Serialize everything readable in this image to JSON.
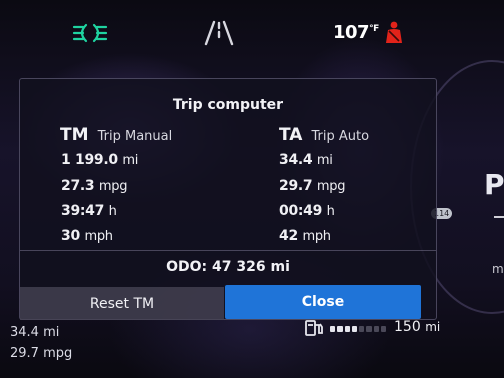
{
  "status_bar": {
    "temperature": "107",
    "temperature_unit": "°F",
    "icons": [
      "headlights-icon",
      "lane-keep-icon",
      "seatbelt-warning-icon"
    ],
    "colors": {
      "headlights": "#1fd3a0",
      "seatbelt": "#e2231a"
    }
  },
  "dialog": {
    "title": "Trip computer",
    "trip_manual": {
      "abbr": "TM",
      "name": "Trip Manual",
      "distance": "1 199.0",
      "distance_unit": "mi",
      "economy": "27.3",
      "economy_unit": "mpg",
      "time": "39:47",
      "time_unit": "h",
      "speed": "30",
      "speed_unit": "mph"
    },
    "trip_auto": {
      "abbr": "TA",
      "name": "Trip Auto",
      "distance": "34.4",
      "distance_unit": "mi",
      "economy": "29.7",
      "economy_unit": "mpg",
      "time": "00:49",
      "time_unit": "h",
      "speed": "42",
      "speed_unit": "mph"
    },
    "odometer_label": "ODO:",
    "odometer_value": "47 326",
    "odometer_unit": "mi",
    "reset_label": "Reset TM",
    "close_label": "Close",
    "close_color": "#1f74d8"
  },
  "cluster": {
    "trip_distance": "34.4 mi",
    "trip_economy": "29.7 mpg",
    "range_value": "150",
    "range_unit": "mi",
    "fuel_level": 0.55,
    "right_letter": "P",
    "right_small": "mi",
    "route_marker": "114"
  }
}
